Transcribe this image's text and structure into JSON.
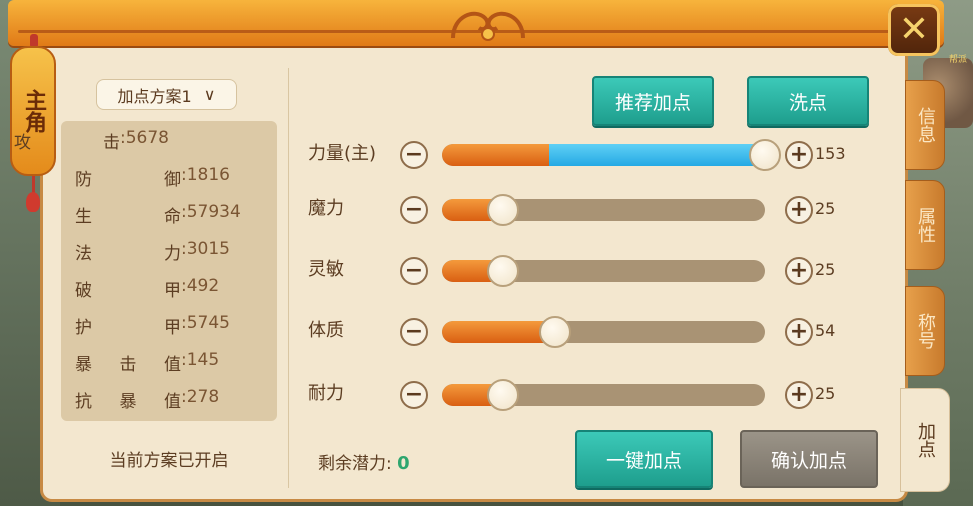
{
  "window": {
    "side_tag": "主角",
    "close_symbol": "✕",
    "npc_label": "帮派"
  },
  "plan": {
    "selected": "加点方案1",
    "status": "当前方案已开启"
  },
  "stats": [
    {
      "label": "攻击",
      "value": ":5678"
    },
    {
      "label": "防御",
      "value": ":1816"
    },
    {
      "label": "生命",
      "value": ":57934"
    },
    {
      "label": "法力",
      "value": ":3015"
    },
    {
      "label": "破甲",
      "value": ":492"
    },
    {
      "label": "护甲",
      "value": ":5745"
    },
    {
      "label": "暴击值",
      "value": ":145"
    },
    {
      "label": "抗暴值",
      "value": ":278"
    }
  ],
  "buttons": {
    "recommend": "推荐加点",
    "reset": "洗点",
    "one_click": "一键加点",
    "confirm": "确认加点"
  },
  "attributes": [
    {
      "label": "力量(主)",
      "value": "153",
      "base_fraction": 0.33,
      "total_fraction": 1.0
    },
    {
      "label": "魔力",
      "value": "25",
      "base_fraction": 0.19,
      "total_fraction": 0.19
    },
    {
      "label": "灵敏",
      "value": "25",
      "base_fraction": 0.19,
      "total_fraction": 0.19
    },
    {
      "label": "体质",
      "value": "54",
      "base_fraction": 0.35,
      "total_fraction": 0.35
    },
    {
      "label": "耐力",
      "value": "25",
      "base_fraction": 0.19,
      "total_fraction": 0.19
    }
  ],
  "remaining": {
    "label": "剩余潜力:",
    "value": "0"
  },
  "tabs": [
    {
      "label": "信息",
      "active": false
    },
    {
      "label": "属性",
      "active": false
    },
    {
      "label": "称号",
      "active": false
    },
    {
      "label": "加点",
      "active": true
    }
  ],
  "icons": {
    "minus": "minus-icon",
    "plus": "plus-icon",
    "chevron": "chevron-down-icon"
  }
}
